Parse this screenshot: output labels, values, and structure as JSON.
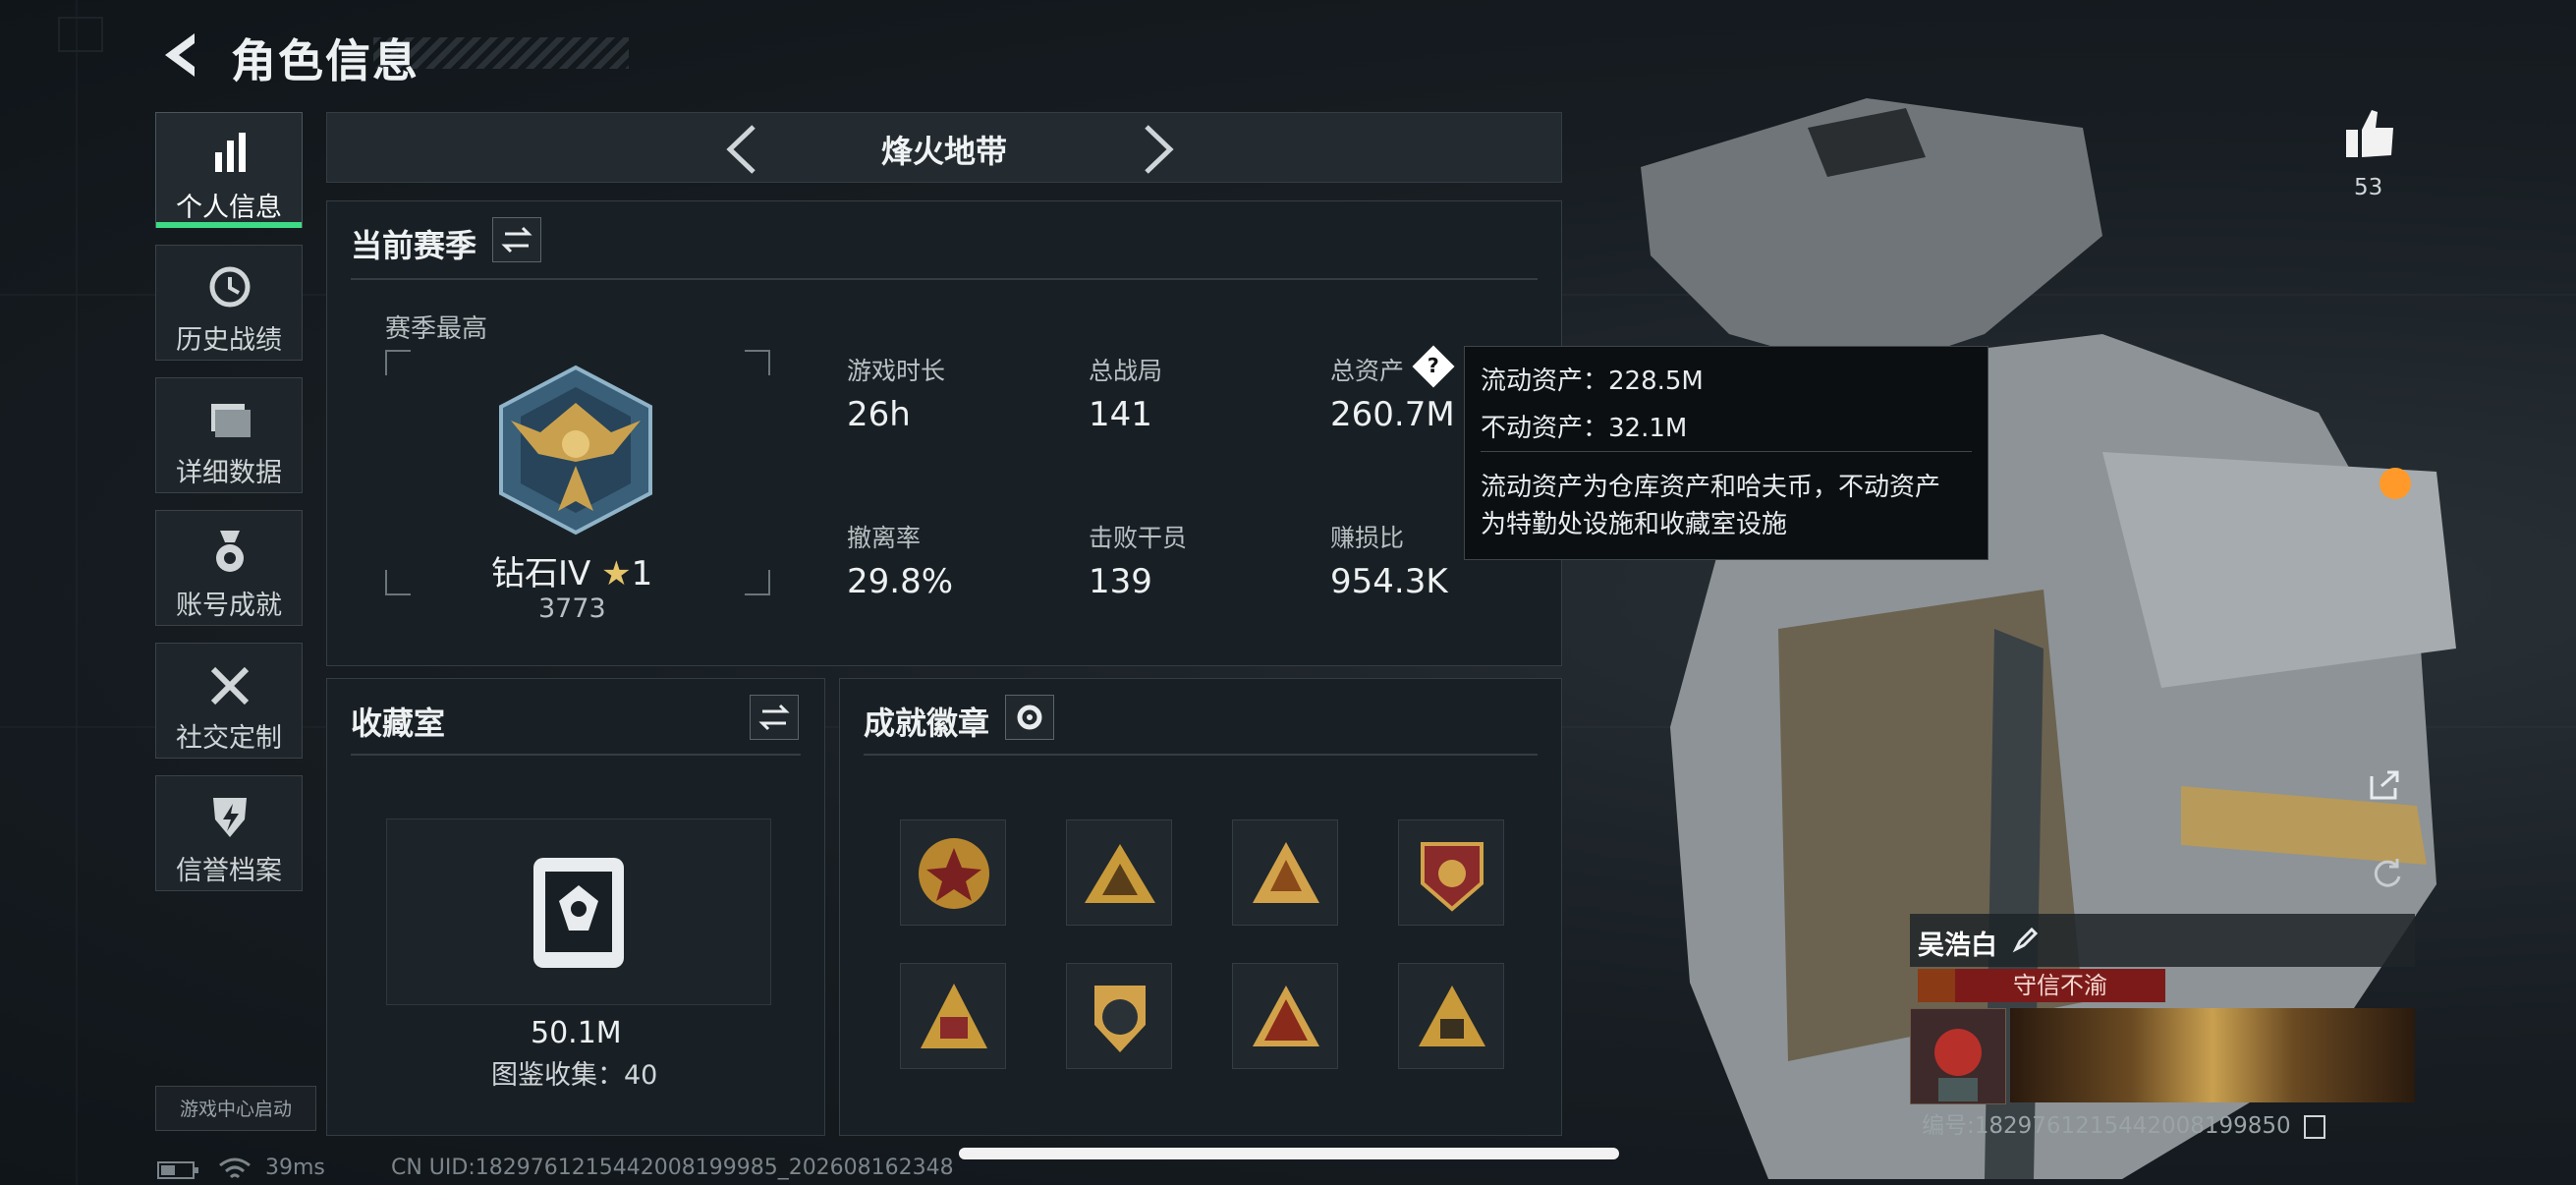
{
  "header": {
    "title": "角色信息"
  },
  "sidebar": {
    "items": [
      {
        "label": "个人信息",
        "icon": "bar-chart-icon",
        "active": true
      },
      {
        "label": "历史战绩",
        "icon": "clock-icon"
      },
      {
        "label": "详细数据",
        "icon": "folder-icon"
      },
      {
        "label": "账号成就",
        "icon": "medal-icon"
      },
      {
        "label": "社交定制",
        "icon": "tools-icon"
      },
      {
        "label": "信誉档案",
        "icon": "shield-icon"
      }
    ],
    "launch_label": "游戏中心启动"
  },
  "mode": {
    "name": "烽火地带"
  },
  "season": {
    "title": "当前赛季",
    "best_label": "赛季最高",
    "rank_name": "钻石IV",
    "rank_stars": "1",
    "rank_points": "3773",
    "stats": [
      {
        "label": "游戏时长",
        "value": "26h"
      },
      {
        "label": "总战局",
        "value": "141"
      },
      {
        "label": "总资产",
        "value": "260.7M"
      },
      {
        "label": "撤离率",
        "value": "29.8%"
      },
      {
        "label": "击败干员",
        "value": "139"
      },
      {
        "label": "赚损比",
        "value": "954.3K"
      }
    ]
  },
  "tooltip": {
    "liquid": "流动资产：228.5M",
    "fixed": "不动资产：32.1M",
    "note_line1": "流动资产为仓库资产和哈夫币，不动资产",
    "note_line2": "为特勤处设施和收藏室设施"
  },
  "vault": {
    "title": "收藏室",
    "value": "50.1M",
    "collection": "图鉴收集：40"
  },
  "achievements": {
    "title": "成就徽章",
    "badge_count": 8
  },
  "profile": {
    "likes": "53",
    "player_name": "吴浩白",
    "honor_title": "守信不渝",
    "uid_label": "编号:1829761215442008199850"
  },
  "status": {
    "ping": "39ms",
    "uid": "CN UID:1829761215442008199985_202608162348"
  },
  "colors": {
    "accent": "#3ddc84",
    "honor": "#7c1a1a",
    "background": "#151b20"
  }
}
